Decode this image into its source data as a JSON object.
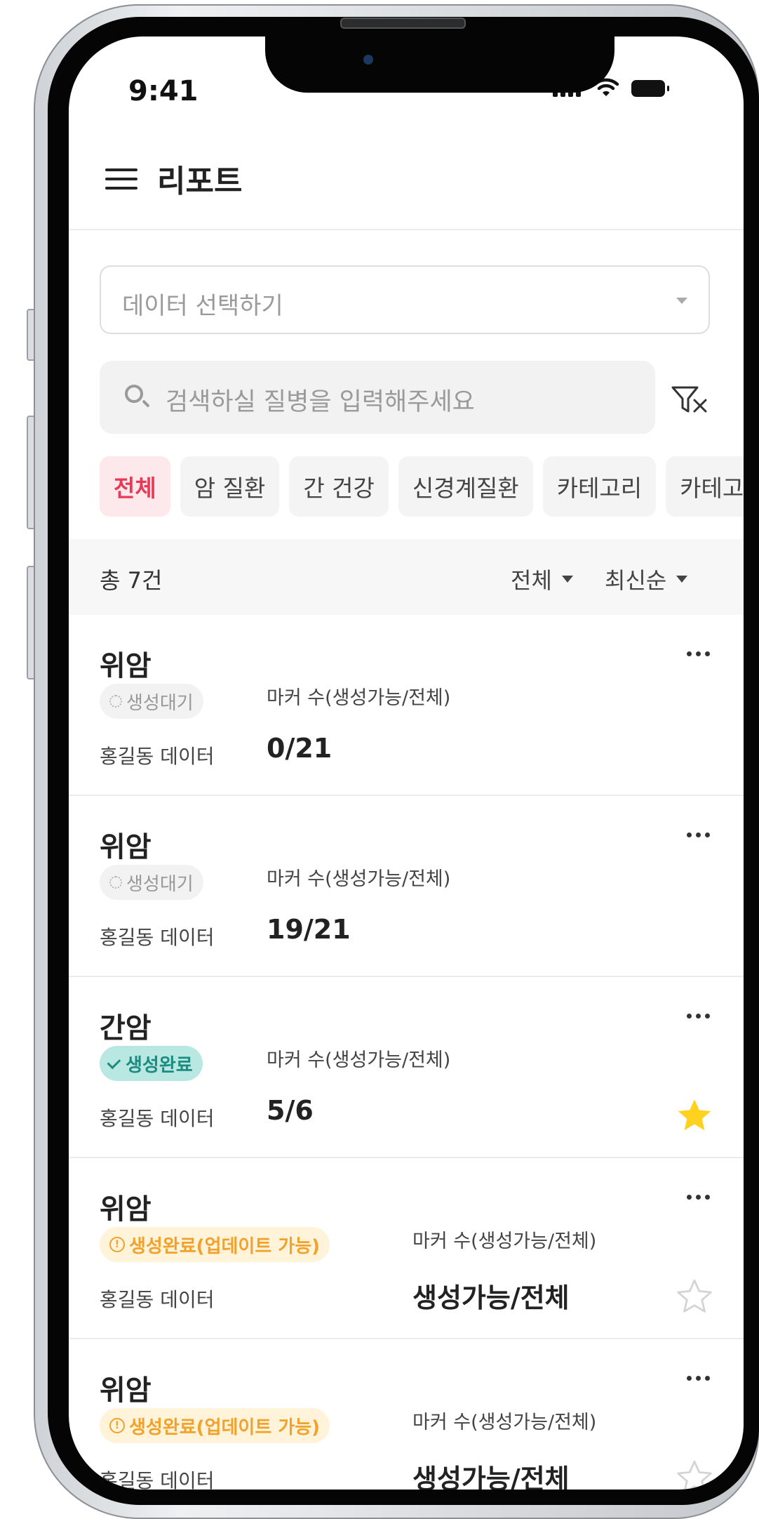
{
  "status": {
    "time": "9:41"
  },
  "header": {
    "title": "리포트"
  },
  "data_select": {
    "placeholder": "데이터 선택하기"
  },
  "search": {
    "placeholder": "검색하실 질병을 입력해주세요"
  },
  "chips": [
    "전체",
    "암 질환",
    "간 건강",
    "신경계질환",
    "카테고리",
    "카테고리"
  ],
  "summary": {
    "count": "총 7건",
    "filter": "전체",
    "sort": "최신순"
  },
  "reports": [
    {
      "title": "위암",
      "status": "생성대기",
      "status_type": "pending",
      "source": "홍길동 데이터",
      "marker_label": "마커 수(생성가능/전체)",
      "marker_value": "0/21",
      "starred": null
    },
    {
      "title": "위암",
      "status": "생성대기",
      "status_type": "pending",
      "source": "홍길동 데이터",
      "marker_label": "마커 수(생성가능/전체)",
      "marker_value": "19/21",
      "starred": null
    },
    {
      "title": "간암",
      "status": "생성완료",
      "status_type": "done",
      "source": "홍길동 데이터",
      "marker_label": "마커 수(생성가능/전체)",
      "marker_value": "5/6",
      "starred": true
    },
    {
      "title": "위암",
      "status": "생성완료(업데이트 가능)",
      "status_type": "update",
      "source": "홍길동 데이터",
      "marker_label": "마커 수(생성가능/전체)",
      "marker_value": "생성가능/전체",
      "starred": false
    },
    {
      "title": "위암",
      "status": "생성완료(업데이트 가능)",
      "status_type": "update",
      "source": "홍길동 데이터",
      "marker_label": "마커 수(생성가능/전체)",
      "marker_value": "생성가능/전체",
      "starred": false
    }
  ],
  "colors": {
    "accent": "#e83a57",
    "accent_bg": "#fde8ec",
    "done_bg": "#b9e7e2",
    "done_text": "#1c8c80",
    "update_bg": "#fff3d9",
    "update_text": "#f2a12a",
    "star": "#ffd21f"
  }
}
